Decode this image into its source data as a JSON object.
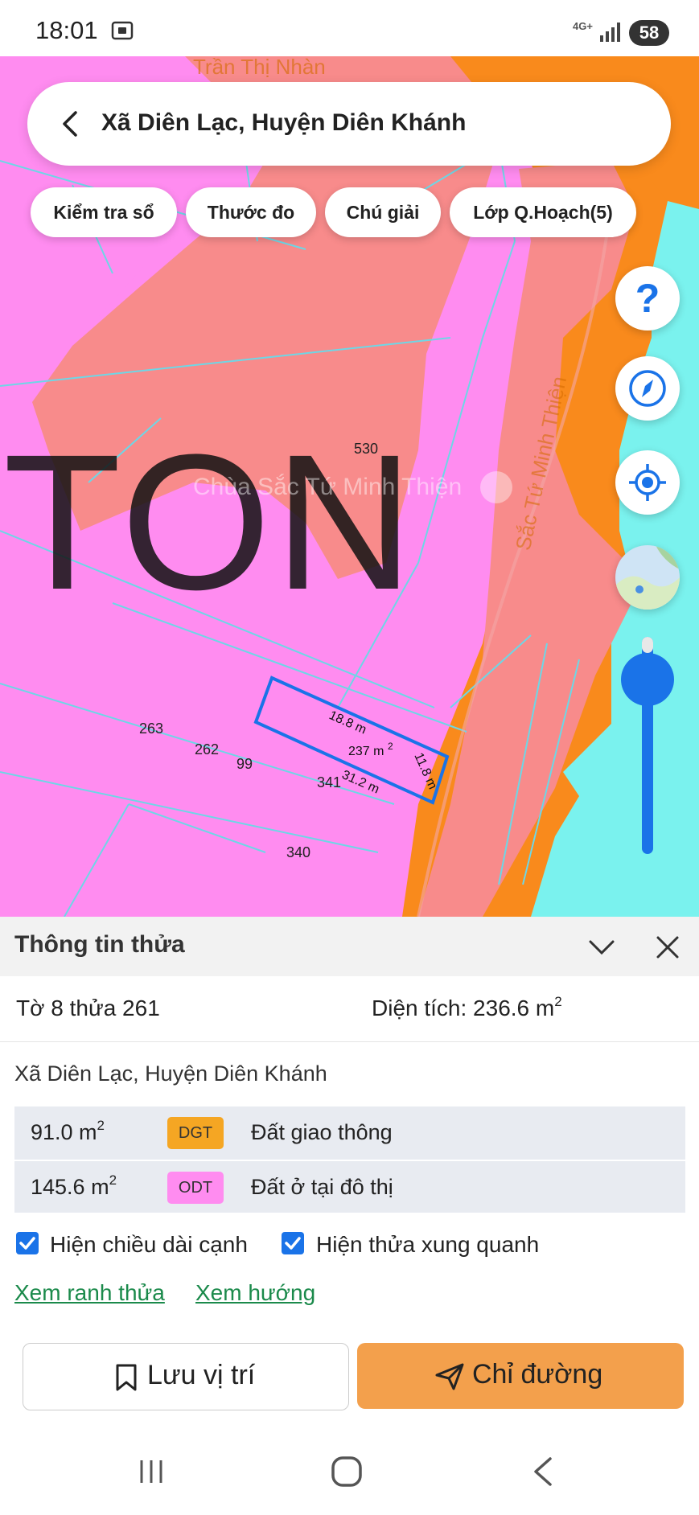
{
  "status_bar": {
    "time": "18:01",
    "network": "4G+",
    "battery": "58"
  },
  "map": {
    "overlay_text": "TON",
    "poi_name": "Chùa Sắc Tứ Minh Thiện",
    "road_label_top": "Trần Thị Nhàn",
    "road_label_right": "Sắc Tứ Minh Thiện",
    "parcel_labels": [
      "530",
      "263",
      "262",
      "99",
      "341",
      "340"
    ],
    "edge_lengths": [
      "18.8 m",
      "11.8 m",
      "31.2 m"
    ],
    "parcel_area_label": "237 m",
    "parcel_area_unit": "2"
  },
  "search": {
    "text": "Xã Diên Lạc, Huyện Diên Khánh"
  },
  "chips": [
    "Kiểm tra sổ",
    "Thước đo",
    "Chú giải",
    "Lớp Q.Hoạch(5)"
  ],
  "fab_help": "?",
  "panel": {
    "title": "Thông tin thửa",
    "parcel_id": "Tờ 8 thửa 261",
    "area_label": "Diện tích: 236.6 m",
    "area_unit": "2",
    "address": "Xã Diên Lạc, Huyện Diên Khánh",
    "land_uses": [
      {
        "area": "91.0 m",
        "unit": "2",
        "code": "DGT",
        "name": "Đất giao thông",
        "color": "#f5a623"
      },
      {
        "area": "145.6 m",
        "unit": "2",
        "code": "ODT",
        "name": "Đất ở tại đô thị",
        "color": "#ff8cf0"
      }
    ],
    "checkbox_edges": "Hiện chiều dài cạnh",
    "checkbox_neighbors": "Hiện thửa xung quanh",
    "link_boundary": "Xem ranh thửa",
    "link_direction": "Xem hướng",
    "button_save": "Lưu vị trí",
    "button_directions": "Chỉ đường"
  },
  "colors": {
    "accent": "#1a73e8",
    "orange": "#f98a1c",
    "pink": "#ff8cf0",
    "salmon": "#f88b8b",
    "cyan": "#7af2ee"
  }
}
